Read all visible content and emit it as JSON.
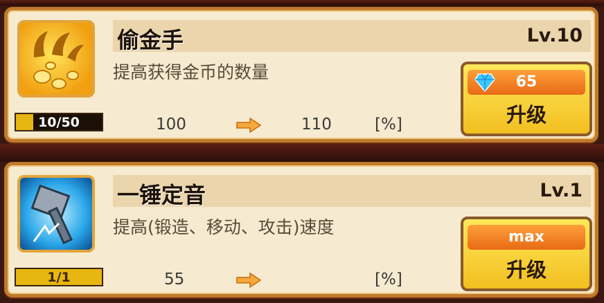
{
  "skills": [
    {
      "name": "偷金手",
      "level": "Lv.10",
      "description": "提高获得金币的数量",
      "progress_text": "10/50",
      "progress_fraction": 0.2,
      "current_value": "100",
      "next_value": "110",
      "unit": "[%]",
      "cost": "65",
      "cost_icon": "diamond-icon",
      "upgrade_label": "升级",
      "icon": "golden-claw-coins-icon"
    },
    {
      "name": "一锤定音",
      "level": "Lv.1",
      "description": "提高(锻造、移动、攻击)速度",
      "progress_text": "1/1",
      "progress_fraction": 1.0,
      "current_value": "55",
      "next_value": "",
      "unit": "[%]",
      "cost": "max",
      "upgrade_label": "升级",
      "icon": "hammer-icon"
    }
  ]
}
